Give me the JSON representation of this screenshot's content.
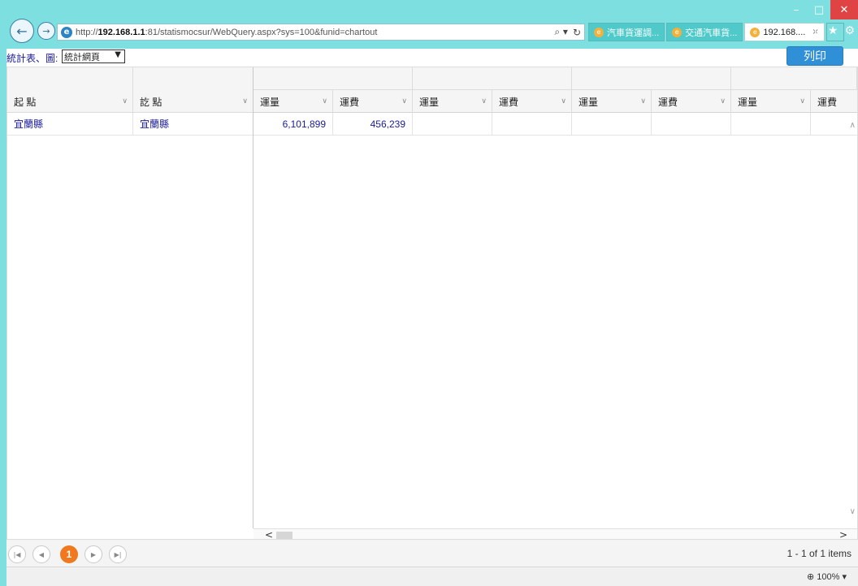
{
  "browser": {
    "url_prefix": "http://",
    "url_host": "192.168.1.1",
    "url_rest": ":81/statismocsur/WebQuery.aspx?sys=100&funid=chartout",
    "search_icon": "search-icon",
    "refresh_icon": "refresh-icon",
    "tabs": [
      {
        "label": "汽車貨運調...",
        "active": false
      },
      {
        "label": "交通汽車貨...",
        "active": false
      },
      {
        "label": "192.168....",
        "active": true
      }
    ],
    "tab_close": "×"
  },
  "toolbar": {
    "report_label": "統計表、圖:",
    "select_value": "統計網頁",
    "print_label": "列印"
  },
  "grid": {
    "columns": [
      {
        "label": "起 點"
      },
      {
        "label": "訖 點"
      },
      {
        "label": "運量"
      },
      {
        "label": "運費"
      },
      {
        "label": "運量"
      },
      {
        "label": "運費"
      },
      {
        "label": "運量"
      },
      {
        "label": "運費"
      },
      {
        "label": "運量"
      },
      {
        "label": "運費"
      }
    ],
    "rows": [
      {
        "origin": "宜蘭縣",
        "destination": "宜蘭縣",
        "volume": "6,101,899",
        "fee": "456,239"
      }
    ]
  },
  "pager": {
    "current_page": "1",
    "info": "1 - 1 of 1 items"
  },
  "status": {
    "zoom": "100%"
  },
  "colors": {
    "chrome": "#7ddfdf",
    "print_button": "#2f8fd7",
    "page_active": "#f0781e",
    "link_text": "#1a1a9a"
  }
}
